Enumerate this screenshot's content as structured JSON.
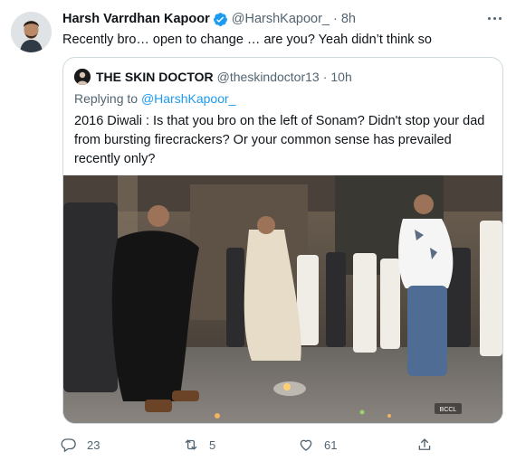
{
  "tweet": {
    "author_name": "Harsh Varrdhan Kapoor",
    "handle": "@HarshKapoor_",
    "separator": "·",
    "time": "8h",
    "text": "Recently bro… open to change … are you? Yeah didn’t think so"
  },
  "quote": {
    "author_name": "THE SKIN DOCTOR",
    "handle": "@theskindoctor13",
    "separator": "·",
    "time": "10h",
    "reply_prefix": "Replying to",
    "reply_mention": "@HarshKapoor_",
    "text": "2016 Diwali : Is that you bro on the left of Sonam? Didn't stop your dad from bursting firecrackers? Or your common sense has prevailed recently only?",
    "photo_credit": "BCCL"
  },
  "actions": {
    "reply_count": "23",
    "retweet_count": "5",
    "like_count": "61"
  },
  "icons": {
    "verified": "verified-badge-icon",
    "more": "more-options-icon",
    "reply": "reply-icon",
    "retweet": "retweet-icon",
    "like": "like-icon",
    "share": "share-icon"
  },
  "colors": {
    "text_primary": "#0f1419",
    "text_secondary": "#536471",
    "accent": "#1d9bf0",
    "border": "#cfd9de"
  }
}
